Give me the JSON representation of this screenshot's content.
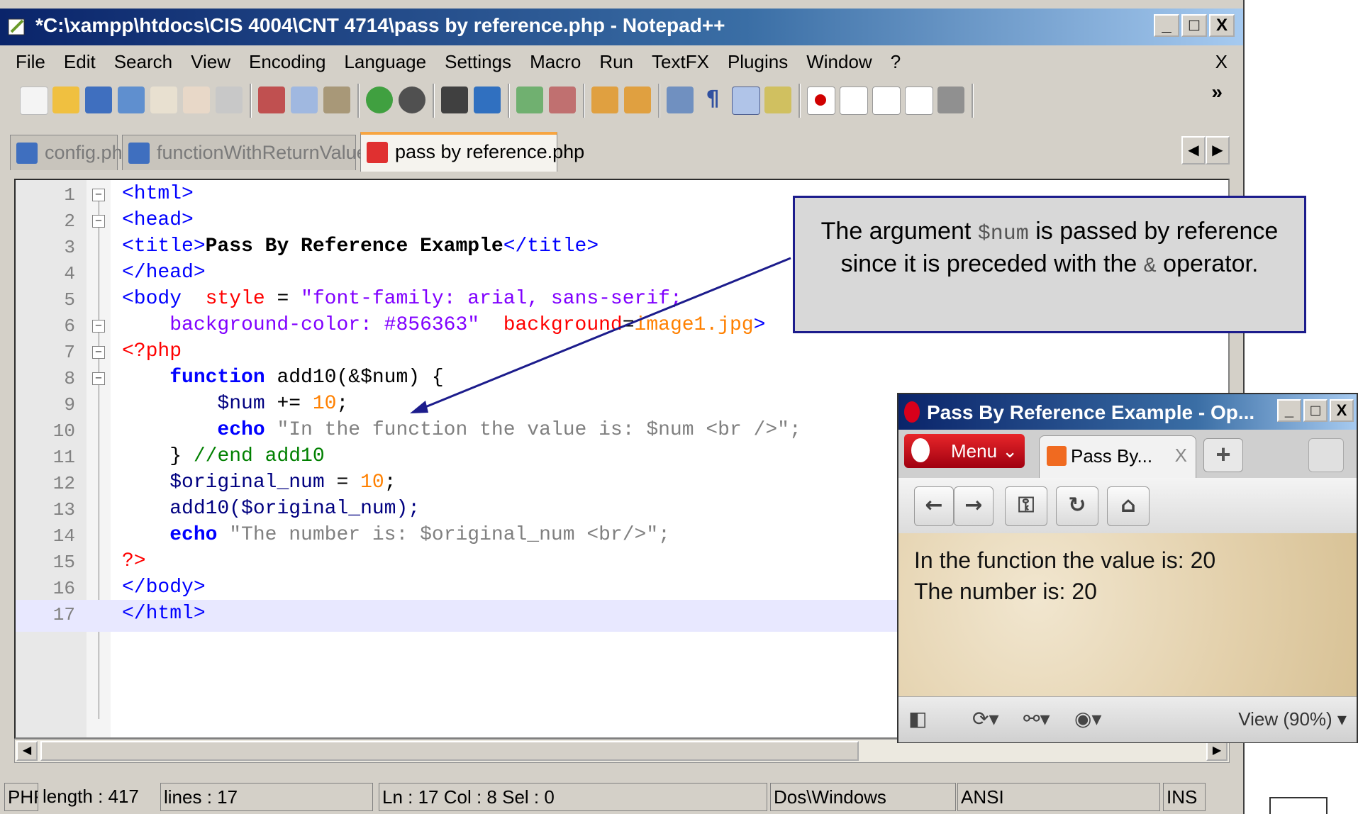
{
  "npp": {
    "title": "*C:\\xampp\\htdocs\\CIS 4004\\CNT 4714\\pass by reference.php - Notepad++",
    "win_min": "_",
    "win_max": "□",
    "win_close": "X",
    "menu": [
      "File",
      "Edit",
      "Search",
      "View",
      "Encoding",
      "Language",
      "Settings",
      "Macro",
      "Run",
      "TextFX",
      "Plugins",
      "Window",
      "?"
    ],
    "menu_close": "X",
    "toolbar_more": "»",
    "tabs": [
      "config.php",
      "functionWithReturnValue.php",
      "pass by reference.php"
    ],
    "tab_left": "◀",
    "tab_right": "▶",
    "line_numbers": [
      "1",
      "2",
      "3",
      "4",
      "5",
      "6",
      "7",
      "8",
      "9",
      "10",
      "11",
      "12",
      "13",
      "14",
      "15",
      "16",
      "17"
    ],
    "code": {
      "l1": "<html>",
      "l2": "<head>",
      "l3_open": "<title>",
      "l3_text": "Pass By Reference Example",
      "l3_close": "</title>",
      "l4": "</head>",
      "l5_tag": "<body",
      "l5_attr": "  style",
      "l5_eq": " = ",
      "l5_str": "\"font-family: arial, sans-serif;",
      "l6_str": "    background-color: #856363\"",
      "l6_attr": "  background",
      "l6_eq": "=",
      "l6_val": "image1.jpg",
      "l6_close": ">",
      "l7": "<?php",
      "l8_kw": "function",
      "l8_rest": " add10(&$num) {",
      "l9_var": "$num",
      "l9_op": " += ",
      "l9_num": "10",
      "l9_semi": ";",
      "l10_kw": "echo",
      "l10_str": " \"In the function the value is: $num <br />\";",
      "l11_brace": "}",
      "l11_cmt": " //end add10",
      "l12_var": "$original_num",
      "l12_op": " = ",
      "l12_num": "10",
      "l12_semi": ";",
      "l13": "add10($original_num);",
      "l14_kw": "echo",
      "l14_str": " \"The number is: $original_num <br/>\";",
      "l15": "?>",
      "l16": "</body>",
      "l17": "</html>"
    },
    "status": {
      "type": "PHF",
      "length": "length : 417",
      "lines": "lines : 17",
      "pos": "Ln : 17   Col : 8   Sel : 0",
      "eol": "Dos\\Windows",
      "enc": "ANSI",
      "mode": "INS"
    }
  },
  "callout": {
    "pre": "The argument ",
    "code": "$num",
    "mid": "  is passed by reference since it is preceded with the ",
    "amp": "&",
    "post": " operator."
  },
  "opera": {
    "title": "Pass By Reference Example - Op...",
    "min": "_",
    "max": "□",
    "close": "X",
    "menu": "Menu ⌄",
    "tab": "Pass By...",
    "tab_close": "X",
    "plus": "+",
    "nav": {
      "back": "←",
      "forward": "→",
      "key": "⚿",
      "reload": "↻",
      "home": "⌂"
    },
    "content": [
      "In the function the value is: 20",
      "The number is: 20"
    ],
    "zoom": "View (90%) ▾"
  },
  "colors": {
    "titlebar": "#0a246a",
    "callout_border": "#1c1c8c",
    "php_red": "#ff0000",
    "tag_blue": "#0000ff"
  }
}
